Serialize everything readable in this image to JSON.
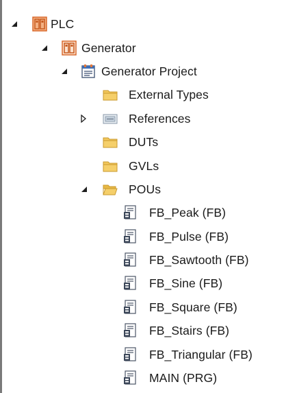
{
  "tree": {
    "nodes": [
      {
        "key": "plc",
        "label": "PLC",
        "icon": "plc-icon",
        "toggle": "expanded"
      },
      {
        "key": "generator",
        "label": "Generator",
        "icon": "plc-project-icon",
        "toggle": "expanded"
      },
      {
        "key": "project",
        "label": "Generator Project",
        "icon": "project-icon",
        "toggle": "expanded"
      },
      {
        "key": "external",
        "label": "External Types",
        "icon": "folder-icon",
        "toggle": "none"
      },
      {
        "key": "references",
        "label": "References",
        "icon": "references-icon",
        "toggle": "collapsed"
      },
      {
        "key": "duts",
        "label": "DUTs",
        "icon": "folder-icon",
        "toggle": "none"
      },
      {
        "key": "gvls",
        "label": "GVLs",
        "icon": "folder-icon",
        "toggle": "none"
      },
      {
        "key": "pous",
        "label": "POUs",
        "icon": "folder-open-icon",
        "toggle": "expanded"
      },
      {
        "key": "fb_peak",
        "label": "FB_Peak (FB)",
        "icon": "pou-icon",
        "toggle": "none"
      },
      {
        "key": "fb_pulse",
        "label": "FB_Pulse (FB)",
        "icon": "pou-icon",
        "toggle": "none"
      },
      {
        "key": "fb_saw",
        "label": "FB_Sawtooth (FB)",
        "icon": "pou-icon",
        "toggle": "none"
      },
      {
        "key": "fb_sine",
        "label": "FB_Sine (FB)",
        "icon": "pou-icon",
        "toggle": "none"
      },
      {
        "key": "fb_square",
        "label": "FB_Square (FB)",
        "icon": "pou-icon",
        "toggle": "none"
      },
      {
        "key": "fb_stairs",
        "label": "FB_Stairs (FB)",
        "icon": "pou-icon",
        "toggle": "none"
      },
      {
        "key": "fb_tri",
        "label": "FB_Triangular (FB)",
        "icon": "pou-icon",
        "toggle": "none"
      },
      {
        "key": "main",
        "label": "MAIN (PRG)",
        "icon": "pou-icon",
        "toggle": "none"
      }
    ]
  },
  "colors": {
    "plc_orange": "#e2783a",
    "folder_yellow": "#e8b845",
    "toggle": "#1e1e1e"
  }
}
